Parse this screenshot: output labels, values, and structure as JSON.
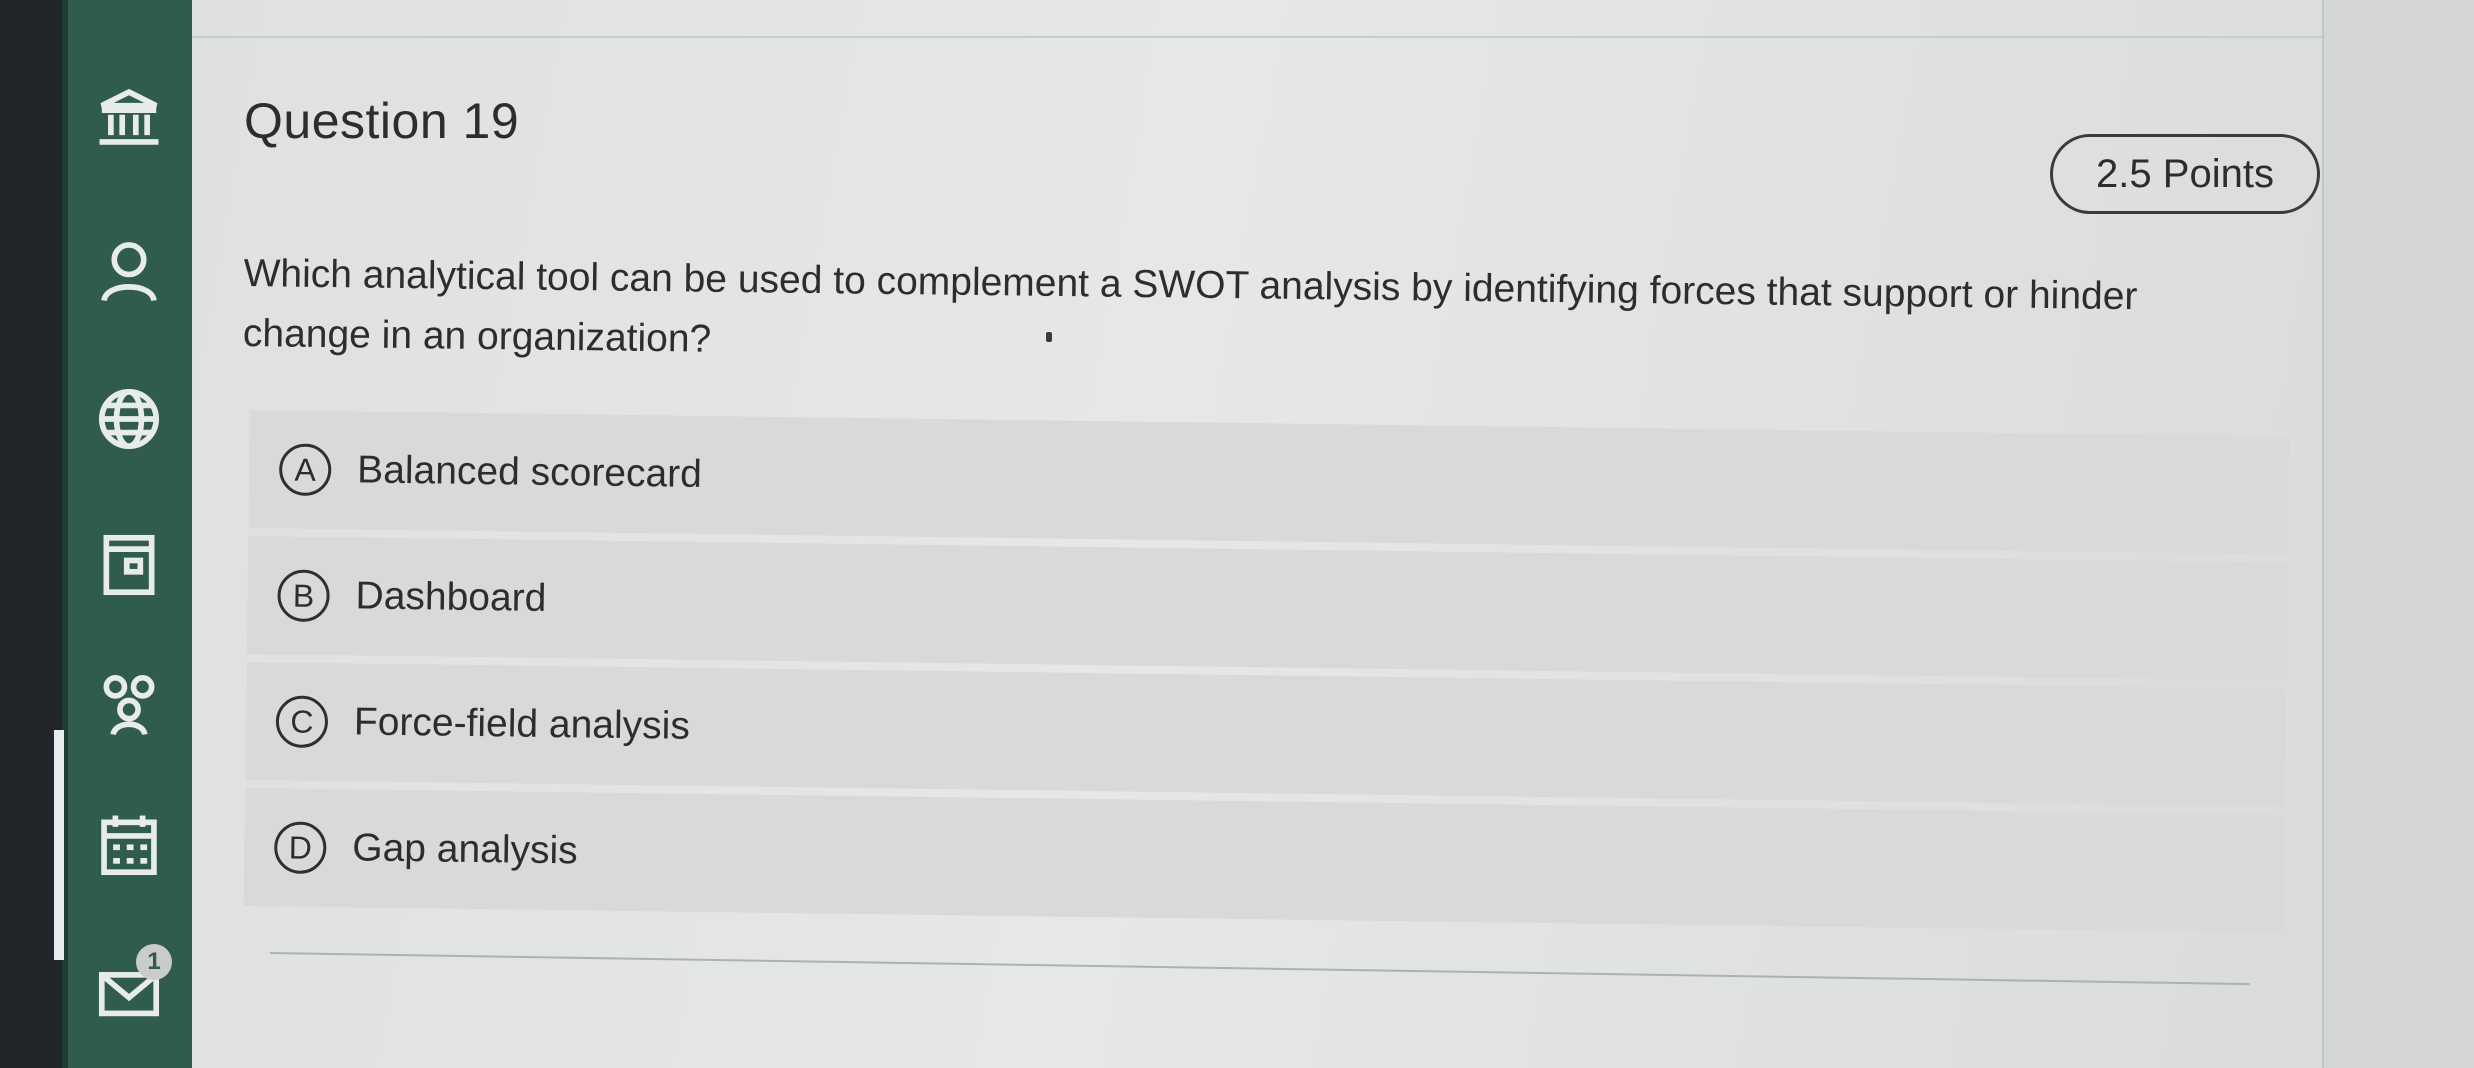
{
  "sidebar": {
    "items": [
      {
        "icon": "institution-icon"
      },
      {
        "icon": "user-icon"
      },
      {
        "icon": "globe-icon"
      },
      {
        "icon": "document-icon"
      },
      {
        "icon": "group-icon"
      },
      {
        "icon": "calendar-icon",
        "active": true
      },
      {
        "icon": "mail-icon",
        "badge": "1"
      }
    ],
    "background_color": "#2f5c4c"
  },
  "question": {
    "title": "Question 19",
    "points": "2.5 Points",
    "prompt": "Which analytical tool can be used to complement a SWOT analysis by identifying forces that support or hinder change in an organization?",
    "options": [
      {
        "letter": "A",
        "label": "Balanced scorecard"
      },
      {
        "letter": "B",
        "label": "Dashboard"
      },
      {
        "letter": "C",
        "label": "Force-field analysis"
      },
      {
        "letter": "D",
        "label": "Gap analysis"
      }
    ]
  }
}
